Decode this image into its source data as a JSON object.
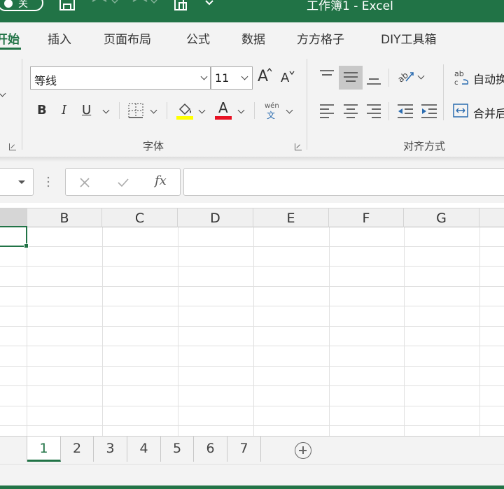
{
  "titlebar": {
    "autosave_label": "关",
    "title": "工作簿1  -  Excel"
  },
  "ribbon_tabs": [
    "开始",
    "插入",
    "页面布局",
    "公式",
    "数据",
    "方方格子",
    "DIY工具箱"
  ],
  "font_group": {
    "font_name": "等线",
    "font_size": "11",
    "grow_label": "A",
    "shrink_label": "A",
    "bold": "B",
    "italic": "I",
    "underline": "U",
    "font_color_label": "A",
    "phonetic_top": "wén",
    "phonetic_bottom": "文",
    "group_label": "字体"
  },
  "alignment_group": {
    "wrap_text": "自动换",
    "merge_center": "合并后",
    "group_label": "对齐方式"
  },
  "formula_bar": {
    "fx_label": "fx",
    "value": ""
  },
  "grid": {
    "columns": [
      "B",
      "C",
      "D",
      "E",
      "F",
      "G"
    ]
  },
  "sheets": {
    "tabs": [
      "1",
      "2",
      "3",
      "4",
      "5",
      "6",
      "7"
    ],
    "active": "1"
  },
  "colors": {
    "accent": "#217346",
    "highlight": "#FFFF00",
    "font_color": "#E81123"
  }
}
